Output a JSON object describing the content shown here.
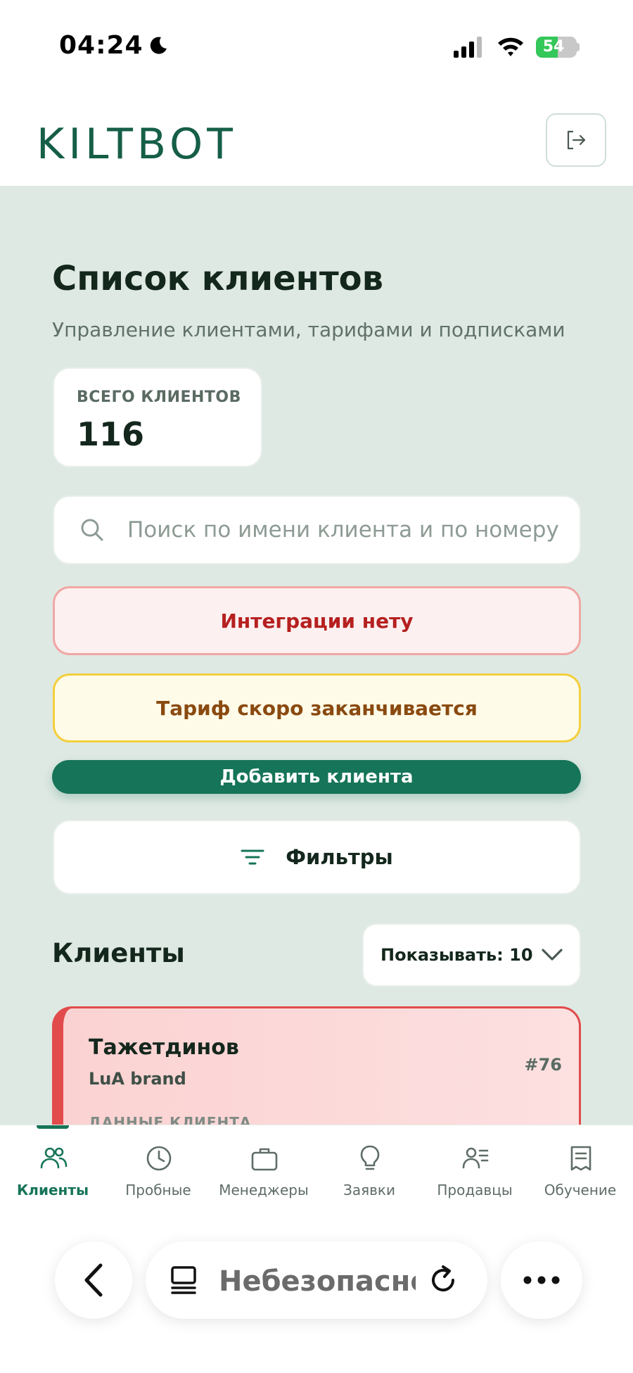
{
  "status_bar": {
    "time": "04:24",
    "battery": "54",
    "battery_level": 0.54
  },
  "header": {
    "logo": "KILTBOT"
  },
  "main": {
    "title": "Список клиентов",
    "subtitle": "Управление клиентами, тарифами и подписками",
    "stat": {
      "label": "ВСЕГО КЛИЕНТОВ",
      "value": "116"
    },
    "search": {
      "placeholder": "Поиск по имени клиента и по номеру",
      "value": ""
    },
    "alerts": {
      "no_integration": "Интеграции нету",
      "tariff_ending": "Тариф скоро заканчивается"
    },
    "add_button": "Добавить клиента",
    "filters_button": "Фильтры",
    "clients_section": {
      "title": "Клиенты",
      "show_select": "Показывать: 10"
    },
    "clients": [
      {
        "name": "Тажетдинов",
        "brand": "LuA brand",
        "id": "#76",
        "section": "ДАННЫЕ КЛИЕНТА"
      }
    ]
  },
  "bottom_nav": {
    "items": [
      {
        "label": "Клиенты",
        "icon": "users-icon",
        "active": true
      },
      {
        "label": "Пробные",
        "icon": "clock-icon",
        "active": false
      },
      {
        "label": "Менеджеры",
        "icon": "briefcase-icon",
        "active": false
      },
      {
        "label": "Заявки",
        "icon": "lightbulb-icon",
        "active": false
      },
      {
        "label": "Продавцы",
        "icon": "user-list-icon",
        "active": false
      },
      {
        "label": "Обучение",
        "icon": "book-icon",
        "active": false
      }
    ]
  },
  "browser": {
    "address": "Небезопасно — kiltbot.kz"
  },
  "colors": {
    "accent": "#167458",
    "background": "#dfe9e4",
    "alert_red": "#b62020",
    "alert_yellow": "#8a4a10",
    "client_card_border": "#e24b4b"
  }
}
